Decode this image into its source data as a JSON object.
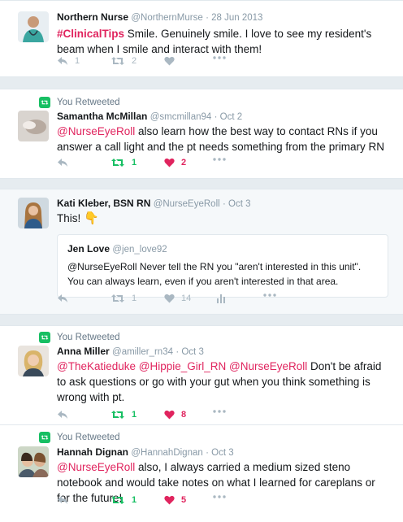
{
  "tweets": [
    {
      "retweeted_label": "",
      "name": "Northern Nurse",
      "handle": "@NorthernMurse",
      "date": "· 28 Jun 2013",
      "hashtag": "#ClinicalTips",
      "mentions": "",
      "text": " Smile. Genuinely smile. I love to see my resident's beam when I smile and interact with them!",
      "emoji": "",
      "reply_count": "1",
      "retweet_count": "2",
      "like_count": "",
      "retweeted": false,
      "liked": false
    },
    {
      "retweeted_label": "You Retweeted",
      "name": "Samantha McMillan",
      "handle": "@smcmillan94",
      "date": "· Oct 2",
      "hashtag": "",
      "mentions": "@NurseEyeRoll",
      "text": " also learn how the best way to contact RNs if you answer a call light and the pt needs something from the primary RN",
      "emoji": "",
      "reply_count": "",
      "retweet_count": "1",
      "like_count": "2",
      "retweeted": true,
      "liked": true
    },
    {
      "retweeted_label": "",
      "name": "Kati Kleber, BSN RN",
      "handle": "@NurseEyeRoll",
      "date": "· Oct 3",
      "hashtag": "",
      "mentions": "",
      "text": "This!",
      "emoji": "👇",
      "reply_count": "",
      "retweet_count": "1",
      "like_count": "14",
      "retweeted": false,
      "liked": false,
      "quote": {
        "name": "Jen Love",
        "handle": "@jen_love92",
        "text": "@NurseEyeRoll Never tell the RN you \"aren't interested in this unit\". You can always learn, even if you aren't interested in that area."
      }
    },
    {
      "retweeted_label": "You Retweeted",
      "name": "Anna Miller",
      "handle": "@amiller_rn34",
      "date": "· Oct 3",
      "hashtag": "",
      "mentions": "@TheKatieduke @Hippie_Girl_RN @NurseEyeRoll",
      "text": " Don't be afraid to ask questions or go with your gut when you think something is wrong with pt.",
      "emoji": "",
      "reply_count": "",
      "retweet_count": "1",
      "like_count": "8",
      "retweeted": true,
      "liked": true
    },
    {
      "retweeted_label": "You Retweeted",
      "name": "Hannah Dignan",
      "handle": "@HannahDignan",
      "date": "· Oct 3",
      "hashtag": "",
      "mentions": "@NurseEyeRoll",
      "text": " also, I always carried a medium sized steno notebook and would take notes on what I learned for careplans or for the future!",
      "emoji": "",
      "reply_count": "",
      "retweet_count": "1",
      "like_count": "5",
      "retweeted": true,
      "liked": true
    }
  ],
  "icons": {
    "reply": "reply-icon",
    "retweet": "retweet-icon",
    "like": "heart-icon",
    "more": "more-icon",
    "analytics": "analytics-icon"
  },
  "colors": {
    "accent": "#e0245e",
    "retweet_green": "#17bf63",
    "muted": "#aab8c2",
    "background": "#e6ecf0"
  }
}
